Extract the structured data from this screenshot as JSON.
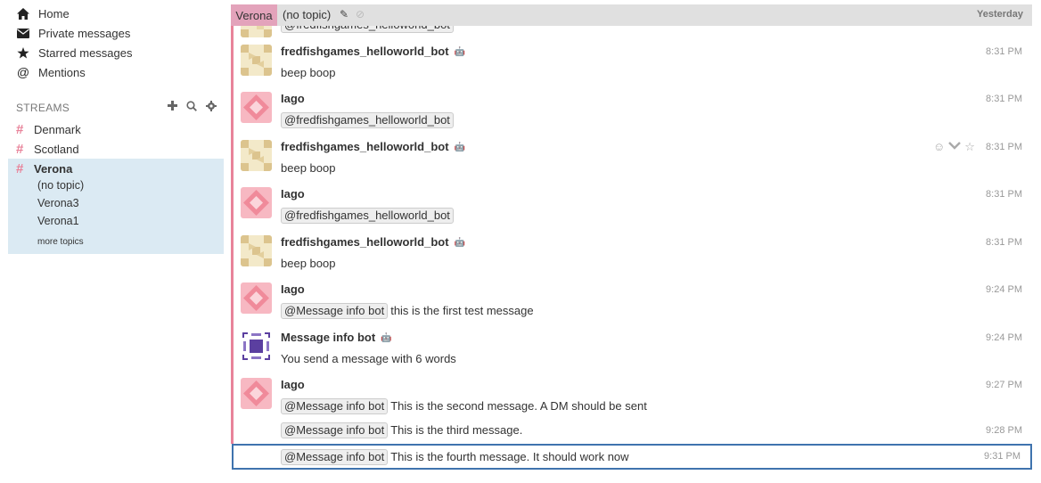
{
  "nav": {
    "home": "Home",
    "private_messages": "Private messages",
    "starred_messages": "Starred messages",
    "mentions": "Mentions"
  },
  "streams": {
    "header": "STREAMS",
    "items": [
      {
        "name": "Denmark"
      },
      {
        "name": "Scotland"
      },
      {
        "name": "Verona"
      }
    ],
    "topics": [
      "(no topic)",
      "Verona3",
      "Verona1"
    ],
    "more_topics": "more topics"
  },
  "recipient_bar": {
    "stream": "Verona",
    "topic": "(no topic)",
    "date": "Yesterday"
  },
  "messages": [
    {
      "sender": "",
      "content_text": "",
      "mention": "@fredfishgames_helloworld_bot",
      "time": "",
      "avatar": "bot"
    },
    {
      "sender": "fredfishgames_helloworld_bot",
      "content_text": "beep boop",
      "mention": "",
      "time": "8:31 PM",
      "avatar": "bot",
      "is_bot": true
    },
    {
      "sender": "Iago",
      "content_text": "",
      "mention": "@fredfishgames_helloworld_bot",
      "time": "8:31 PM",
      "avatar": "iago"
    },
    {
      "sender": "fredfishgames_helloworld_bot",
      "content_text": "beep boop",
      "mention": "",
      "time": "8:31 PM",
      "avatar": "bot",
      "is_bot": true
    },
    {
      "sender": "Iago",
      "content_text": "",
      "mention": "@fredfishgames_helloworld_bot",
      "time": "8:31 PM",
      "avatar": "iago"
    },
    {
      "sender": "fredfishgames_helloworld_bot",
      "content_text": "beep boop",
      "mention": "",
      "time": "8:31 PM",
      "avatar": "bot",
      "is_bot": true
    },
    {
      "sender": "Iago",
      "content_text": "this is the first test message",
      "mention": "@Message info bot",
      "time": "9:24 PM",
      "avatar": "iago"
    },
    {
      "sender": "Message info bot",
      "content_text": "You send a message with 6 words",
      "mention": "",
      "time": "9:24 PM",
      "avatar": "infobot",
      "is_bot": true
    },
    {
      "sender": "Iago",
      "content_text": "This is the second message. A DM should be sent",
      "mention": "@Message info bot",
      "time": "9:27 PM",
      "avatar": "iago"
    },
    {
      "sender": "",
      "content_text": "This is the third message.",
      "mention": "@Message info bot",
      "time": "9:28 PM"
    },
    {
      "sender": "",
      "content_text": "This is the fourth message. It should work now",
      "mention": "@Message info bot",
      "time": "9:31 PM"
    }
  ],
  "icons": {
    "home": "home-icon",
    "private": "envelope-icon",
    "starred": "star-icon",
    "mentions": "at-icon",
    "add": "plus-icon",
    "search": "search-icon",
    "settings": "gear-icon",
    "edit": "pencil-icon",
    "mute": "mute-icon",
    "bot": "bot-icon",
    "emoji": "smiley-icon",
    "menu": "chevron-down-icon",
    "star": "star-outline-icon"
  },
  "colors": {
    "stream_verona": "#e8839a",
    "active_bg": "#dbeaf3",
    "selected_border": "#3f73ae",
    "header_bg": "#e0e0e0"
  }
}
